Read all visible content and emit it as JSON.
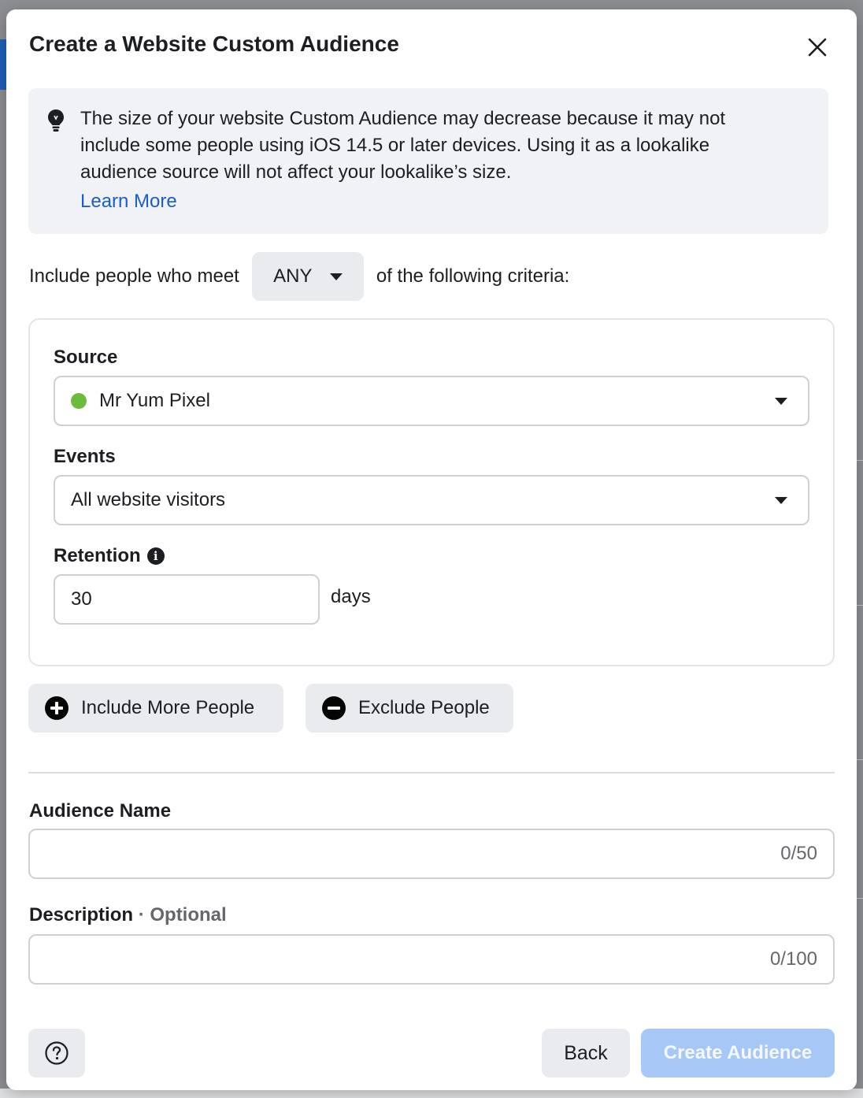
{
  "dialog": {
    "title": "Create a Website Custom Audience",
    "close_icon": "close-icon"
  },
  "notice": {
    "icon": "lightbulb-icon",
    "text": "The size of your website Custom Audience may decrease because it may not include some people using iOS 14.5 or later devices. Using it as a lookalike audience source will not affect your lookalike’s size.",
    "link": "Learn More",
    "link_color": "#1a5ec9"
  },
  "criteria": {
    "prefix": "Include people who meet",
    "match_value": "ANY",
    "suffix": "of the following criteria:"
  },
  "rule": {
    "source_label": "Source",
    "source_value": "Mr Yum Pixel",
    "source_status_color": "#6cbc3c",
    "events_label": "Events",
    "events_value": "All website visitors",
    "retention_label": "Retention",
    "retention_value": "30",
    "retention_unit": "days"
  },
  "actions": {
    "include_more": "Include More People",
    "exclude": "Exclude People"
  },
  "audience_name": {
    "label": "Audience Name",
    "value": "",
    "counter": "0/50"
  },
  "description": {
    "label": "Description",
    "optional": "· Optional",
    "value": "",
    "counter": "0/100"
  },
  "footer": {
    "help_icon": "help-icon",
    "back": "Back",
    "create": "Create Audience",
    "create_color": "#a7c8f7"
  }
}
